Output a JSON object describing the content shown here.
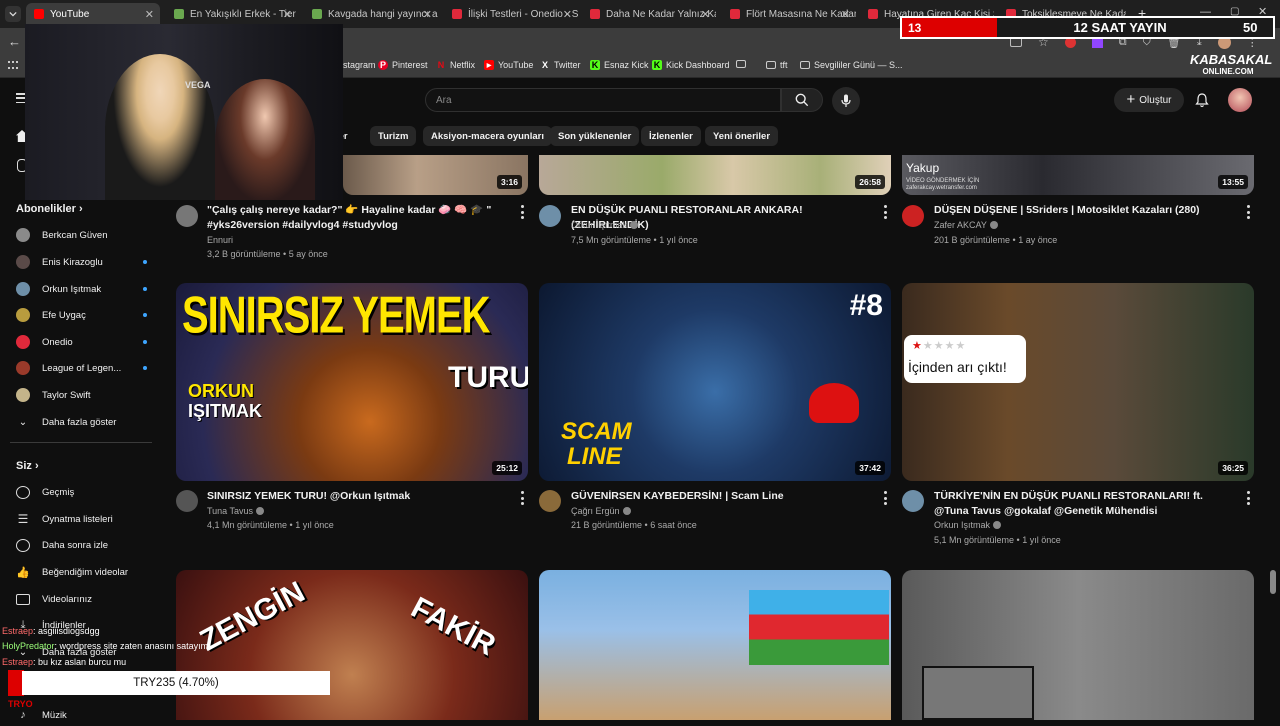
{
  "browser": {
    "tabs": [
      {
        "label": "YouTube",
        "active": true
      },
      {
        "label": "En Yakışıklı Erkek - Tier Lis"
      },
      {
        "label": "Kavgada hangi yayıncı alır"
      },
      {
        "label": "İlişki Testleri - Onedio - Su"
      },
      {
        "label": "Daha Ne Kadar Yalnız Kala"
      },
      {
        "label": "Flört Masasına Ne Kadar"
      },
      {
        "label": "Hayatına Giren Kaç Kişi S"
      },
      {
        "label": "Toksikleşmeye Ne Kadar"
      }
    ],
    "bookmarks": [
      {
        "label": "stagram"
      },
      {
        "label": "Pinterest"
      },
      {
        "label": "Netflix"
      },
      {
        "label": "YouTube"
      },
      {
        "label": "Twitter"
      },
      {
        "label": "Esnaz Kick"
      },
      {
        "label": "Kick Dashboard"
      },
      {
        "label": "tft"
      },
      {
        "label": "Sevgililer Günü — S..."
      }
    ]
  },
  "overlay": {
    "stream_left": "13",
    "stream_title": "12 SAAT YAYIN",
    "stream_right": "50",
    "brand_line1": "KABASAKAL",
    "brand_line2": "ONLINE.COM",
    "donation_text": "TRY235 (4.70%)",
    "webcam_brand": "VEGA",
    "chat": [
      {
        "user": "Estraep",
        "text": ": asgiiisdiogsdgg"
      },
      {
        "user": "HolyPredator",
        "text": ": wordpress site zaten anasını satayım"
      },
      {
        "user": "Estraep",
        "text": ": bu kız aslan burcu mu"
      },
      {
        "user": "TRYO",
        "text": ""
      }
    ]
  },
  "youtube": {
    "search_placeholder": "Ara",
    "create_label": "Oluştur",
    "chips": [
      "ler",
      "Turizm",
      "Aksiyon-macera oyunları",
      "Son yüklenenler",
      "İzlenenler",
      "Yeni öneriler"
    ],
    "sidebar": {
      "subs_header": "Abonelikler",
      "subs": [
        {
          "label": "Berkcan Güven",
          "dot": false,
          "color": "#8a8a8a"
        },
        {
          "label": "Enis Kirazoglu",
          "dot": true,
          "color": "#5a4a48"
        },
        {
          "label": "Orkun Işıtmak",
          "dot": true,
          "color": "#6e8fa8"
        },
        {
          "label": "Efe Uygaç",
          "dot": true,
          "color": "#b89c3e"
        },
        {
          "label": "Onedio",
          "dot": true,
          "color": "#e0293b"
        },
        {
          "label": "League of Legen...",
          "dot": true,
          "color": "#9a3a2a"
        },
        {
          "label": "Taylor Swift",
          "dot": false,
          "color": "#c4b48a"
        }
      ],
      "more_label": "Daha fazla göster",
      "you_header": "Siz",
      "you_items": [
        {
          "label": "Geçmiş",
          "icon": "history-icon"
        },
        {
          "label": "Oynatma listeleri",
          "icon": "playlist-icon"
        },
        {
          "label": "Daha sonra izle",
          "icon": "clock-icon"
        },
        {
          "label": "Beğendiğim videolar",
          "icon": "like-icon"
        },
        {
          "label": "Videolarınız",
          "icon": "video-icon"
        },
        {
          "label": "İndirilenler",
          "icon": "download-icon"
        },
        {
          "label": "Daha fazla göster",
          "icon": "chevron-down-icon"
        },
        {
          "label": "Müzik",
          "icon": "music-icon"
        }
      ]
    },
    "videos_row1": [
      {
        "title": "\"Çalış çalış nereye kadar?\" 👉 Hayaline kadar 🧼 🧠 🎓 \" #yks26version #dailyvlog4 #studyvlog",
        "channel": "Ennuri",
        "meta": "3,2 B görüntüleme • 5 ay önce",
        "duration": "3:16"
      },
      {
        "title": "EN DÜŞÜK PUANLI RESTORANLAR ANKARA! (ZEHİRLENDİK)",
        "channel": "Orkun Işıtmak",
        "meta": "7,5 Mn görüntüleme • 1 yıl önce",
        "duration": "26:58"
      },
      {
        "title": "DÜŞEN DÜŞENE | 5Sriders | Motosiklet Kazaları (280)",
        "channel": "Zafer AKCAY",
        "meta": "201 B görüntüleme • 1 ay önce",
        "duration": "13:55",
        "thumb_text1": "Yakup",
        "thumb_text2": "VİDEO GÖNDERMEK İÇİN",
        "thumb_text3": "zaferakcay.wetransfer.com"
      }
    ],
    "videos_row2": [
      {
        "title": "SINIRSIZ YEMEK TURU! @Orkun Işıtmak",
        "channel": "Tuna Tavus",
        "meta": "4,1 Mn görüntüleme • 1 yıl önce",
        "duration": "25:12",
        "thumb_big": "SINIRSIZ YEMEK",
        "thumb_name1": "ORKUN",
        "thumb_name2": "IŞITMAK",
        "thumb_turu": "TURU!"
      },
      {
        "title": "GÜVENİRSEN KAYBEDERSİN! | Scam Line",
        "channel": "Çağrı Ergün",
        "meta": "21 B görüntüleme • 6 saat önce",
        "duration": "37:42",
        "thumb_num": "#8",
        "thumb_scam1": "SCAM",
        "thumb_scam2": "LINE"
      },
      {
        "title": "TÜRKİYE'NİN EN DÜŞÜK PUANLI RESTORANLARI! ft. @Tuna Tavus @gokalaf @Genetik Mühendisi",
        "channel": "Orkun Işıtmak",
        "meta": "5,1 Mn görüntüleme • 1 yıl önce",
        "duration": "36:25",
        "thumb_bubble": "İçinden arı çıktı!"
      }
    ],
    "videos_row3": [
      {
        "thumb_t1": "ZENGİN",
        "thumb_t2": "FAKİR"
      },
      {},
      {}
    ]
  }
}
